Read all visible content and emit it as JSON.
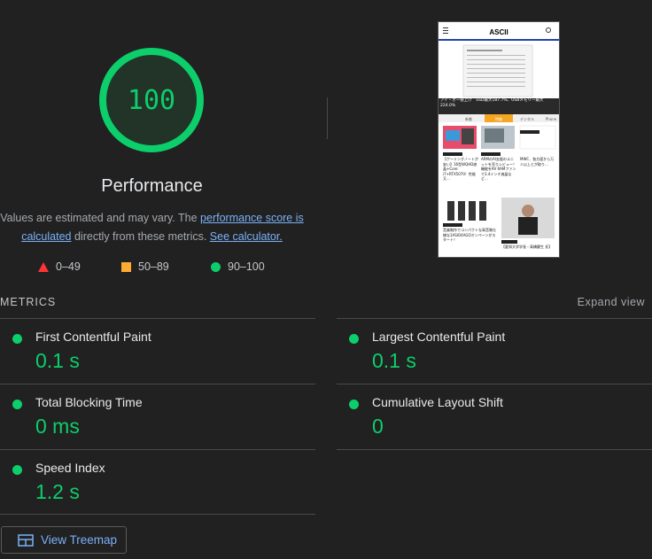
{
  "score": {
    "value": "100",
    "label": "Performance",
    "color": "#0cce6b"
  },
  "note": {
    "prefix": "Values are estimated and may vary. The ",
    "link1": "performance score is calculated",
    "middle": " directly from these metrics. ",
    "link2": "See calculator."
  },
  "legend": [
    {
      "range": "0–49",
      "icon": "red-triangle-icon",
      "color": "#ff3333"
    },
    {
      "range": "50–89",
      "icon": "orange-square-icon",
      "color": "#ffaa33"
    },
    {
      "range": "90–100",
      "icon": "green-circle-icon",
      "color": "#0cce6b"
    }
  ],
  "metrics_header": "METRICS",
  "expand_view": "Expand view",
  "metrics": [
    {
      "label": "First Contentful Paint",
      "value": "0.1 s"
    },
    {
      "label": "Largest Contentful Paint",
      "value": "0.1 s"
    },
    {
      "label": "Total Blocking Time",
      "value": "0 ms"
    },
    {
      "label": "Cumulative Layout Shift",
      "value": "0"
    },
    {
      "label": "Speed Index",
      "value": "1.2 s"
    }
  ],
  "treemap_button": "View Treemap",
  "thumbnail": {
    "brand": "ASCII",
    "banner": "アイ・オー値上げ　SSD最大187.7%、USBメモリー最大224.0%",
    "tabs": [
      "新着",
      "特集",
      "デジタル",
      "Phone"
    ],
    "active_tab": "特集",
    "cards": [
      {
        "tag": "ゲーミングPC",
        "text": "【ゲーミングノートが安い】16型WQHD液晶+Core i7+RTX5070！性能又..."
      },
      {
        "tag": "スマホ",
        "text": "ARMのAI支援のユニットを売りレビュー！ 機能を9V RAMファンで3.4インチ液晶など..."
      },
      {
        "tag": "ビジネス",
        "text": "MWC、各方面から万人以上とが取り..."
      },
      {
        "tag": "トピックス",
        "text": "音楽制作でコンパクトな高音質仕様な1ASIO4AGOオンペーンがスタート！"
      },
      {
        "tag": "ニュース",
        "text": "【愛知大学学長・高橋慶生 氏】"
      }
    ]
  }
}
